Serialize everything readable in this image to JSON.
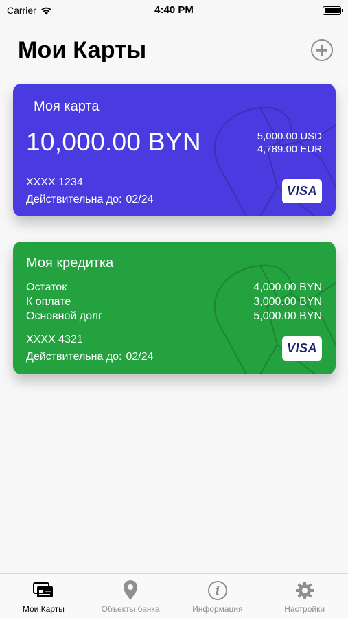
{
  "status_bar": {
    "carrier": "Carrier",
    "time": "4:40 PM"
  },
  "header": {
    "title": "Мои Карты"
  },
  "cards": [
    {
      "title": "Моя карта",
      "balance": "10,000.00 BYN",
      "other_balances": [
        "5,000.00 USD",
        "4,789.00 EUR"
      ],
      "number": "XXXX 1234",
      "valid_label": "Действительна до:",
      "valid_date": "02/24",
      "brand": "VISA",
      "color": "#4a3be0"
    },
    {
      "title": "Моя кредитка",
      "rows": [
        {
          "label": "Остаток",
          "value": "4,000.00 BYN"
        },
        {
          "label": "К оплате",
          "value": "3,000.00 BYN"
        },
        {
          "label": "Основной долг",
          "value": "5,000.00 BYN"
        }
      ],
      "number": "XXXX 4321",
      "valid_label": "Действительна до:",
      "valid_date": "02/24",
      "brand": "VISA",
      "color": "#24a240"
    }
  ],
  "tabs": [
    {
      "label": "Мои Карты",
      "icon": "cards-icon",
      "active": true
    },
    {
      "label": "Объекты банка",
      "icon": "location-pin-icon",
      "active": false
    },
    {
      "label": "Информация",
      "icon": "info-icon",
      "active": false
    },
    {
      "label": "Настройки",
      "icon": "gear-icon",
      "active": false
    }
  ],
  "colors": {
    "accent_gray": "#8e8e93",
    "background": "#f7f7f7"
  }
}
